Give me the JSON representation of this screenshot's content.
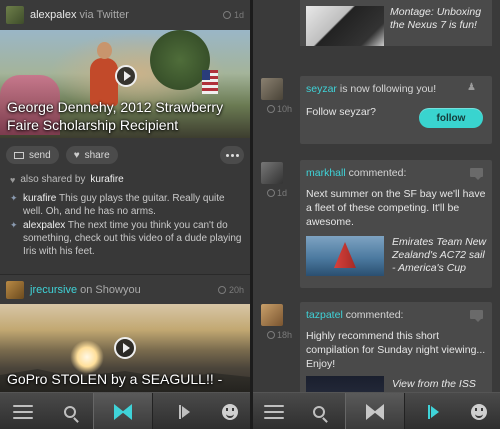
{
  "left_feed": {
    "post1": {
      "username": "alexpalex",
      "via": "via Twitter",
      "time": "1d",
      "video_title": "George Dennehy, 2012 Strawberry Faire Scholarship Recipient",
      "send_label": "send",
      "share_label": "share",
      "shared_prefix": "also shared by",
      "shared_by": "kurafire",
      "comments": [
        {
          "user": "kurafire",
          "text": "This guy plays the guitar. Really quite well. Oh, and he has no arms."
        },
        {
          "user": "alexpalex",
          "text": "The next time you think you can't do something, check out this video of a dude playing Iris with his feet."
        }
      ]
    },
    "post2": {
      "username": "jrecursive",
      "via": "on Showyou",
      "time": "20h",
      "video_title": "GoPro STOLEN by a SEAGULL!! -"
    }
  },
  "right_feed": {
    "card1": {
      "caption": "Montage: Unboxing the Nexus 7 is fun!"
    },
    "follow_notif": {
      "user": "seyzar",
      "action": "is now following you!",
      "time": "10h",
      "prompt": "Follow seyzar?",
      "button_label": "follow"
    },
    "comment1": {
      "user": "markhall",
      "action": "commented:",
      "time": "1d",
      "text": "Next summer on the SF bay we'll have a fleet of these competing. It'll be awesome.",
      "caption": "Emirates Team New Zealand's AC72 sail - America's Cup"
    },
    "comment2": {
      "user": "tazpatel",
      "action": "commented:",
      "time": "18h",
      "text": "Highly recommend this short compilation for Sunday night viewing... Enjoy!",
      "caption": "View from the ISS"
    }
  },
  "colors": {
    "accent": "#3fd3d8",
    "background": "#383838",
    "card": "#4a4a4a"
  },
  "icons": {
    "nav": [
      "menu-icon",
      "search-icon",
      "showyou-logo-icon",
      "flag-icon",
      "smiley-icon"
    ]
  }
}
